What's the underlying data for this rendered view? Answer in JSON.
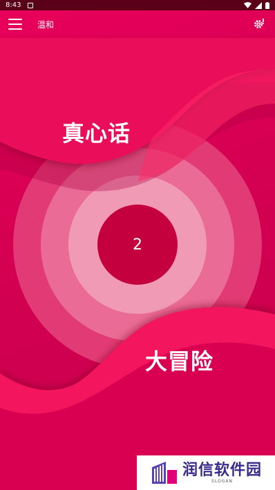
{
  "status_bar": {
    "time": "8:43"
  },
  "app_bar": {
    "title": "温和"
  },
  "game": {
    "truth_label": "真心话",
    "dare_label": "大冒险",
    "center_number": "2"
  },
  "watermark": {
    "text": "润信软件园",
    "slogan": "SLOGAN"
  },
  "colors": {
    "background": "#d40052",
    "status_bar": "#5a0019",
    "wave": "#ff1f63",
    "center_circle": "#c4003f",
    "watermark_text": "#3a2a8c"
  }
}
